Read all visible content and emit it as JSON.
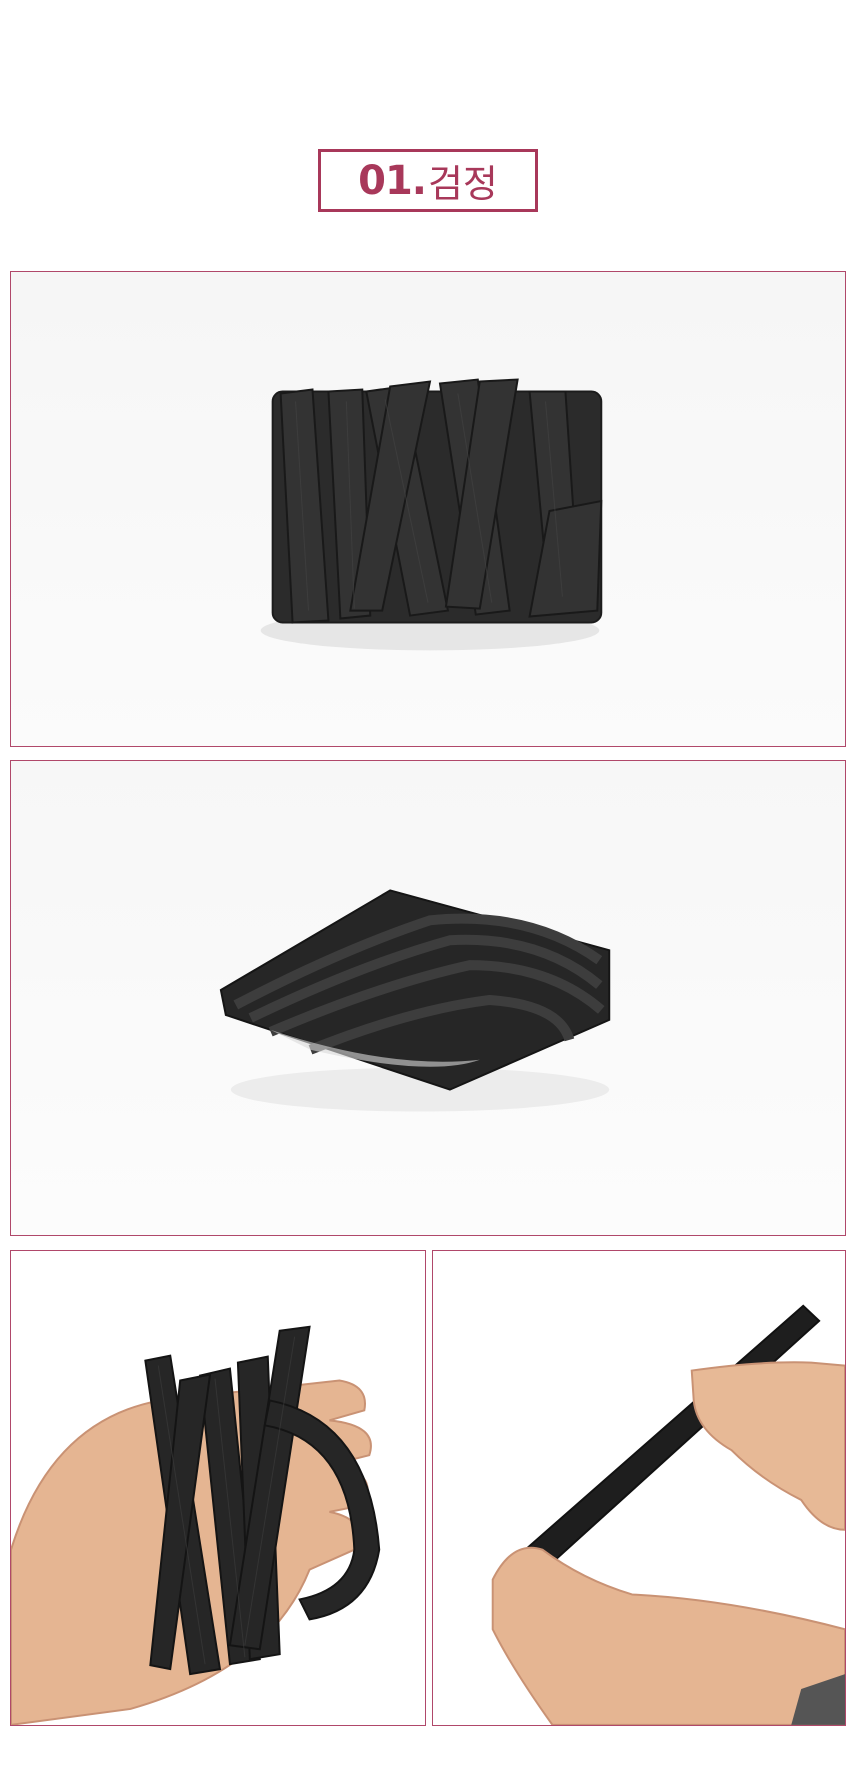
{
  "heading": {
    "number": "01.",
    "color_name": "검정"
  },
  "colors": {
    "accent": "#a8385a",
    "band": "#2a2a2a",
    "skin": "#e8b896"
  },
  "photos": [
    {
      "subject": "black-elastic-band-bundle-front"
    },
    {
      "subject": "black-elastic-band-bundle-angled"
    },
    {
      "subject": "hand-holding-elastic-bundle"
    },
    {
      "subject": "hands-stretching-elastic-band"
    }
  ]
}
